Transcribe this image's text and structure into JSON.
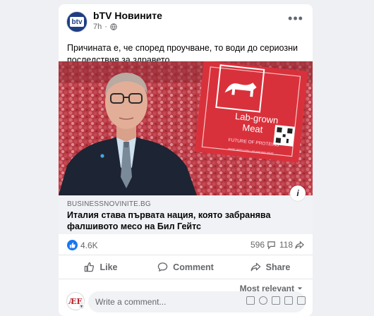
{
  "post": {
    "page_name": "bTV Новините",
    "avatar_text": "btv",
    "time": "7h",
    "text": "Причината е, че според проучване, то води до сериозни последствия за здравето",
    "image": {
      "label_line1": "Lab-grown",
      "label_line2": "Meat",
      "label_line3": "FUTURE OF PROTEINS",
      "label_small": "MADE WITH 100% LAB-GROWN MEAT"
    },
    "link": {
      "domain": "BUSINESSNOVINITE.BG",
      "headline": "Италия става първата нация, която забранява фалшивото месо на Бил Гейтс"
    }
  },
  "stats": {
    "likes": "4.6K",
    "comments": "596",
    "shares": "118"
  },
  "actions": {
    "like": "Like",
    "comment": "Comment",
    "share": "Share"
  },
  "sort": {
    "label": "Most relevant"
  },
  "composer": {
    "placeholder": "Write a comment...",
    "avatar_text": "ÆE"
  },
  "colors": {
    "brand_blue": "#1877f2",
    "meat_red": "#c8323a"
  }
}
